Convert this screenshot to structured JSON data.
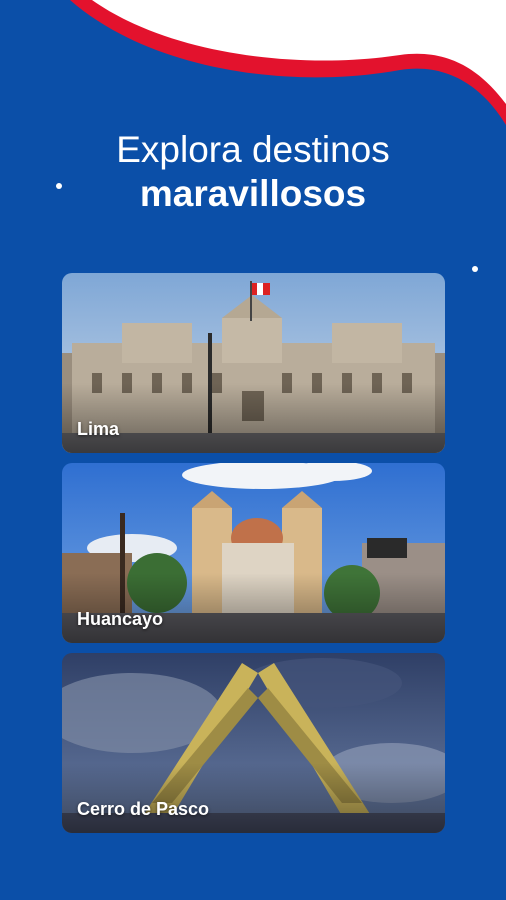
{
  "heading": {
    "line1": "Explora destinos",
    "line2": "maravillosos"
  },
  "colors": {
    "background": "#0b4fa8",
    "wave_white": "#ffffff",
    "wave_red": "#e3122d"
  },
  "destinations": [
    {
      "name": "Lima"
    },
    {
      "name": "Huancayo"
    },
    {
      "name": "Cerro de Pasco"
    }
  ]
}
